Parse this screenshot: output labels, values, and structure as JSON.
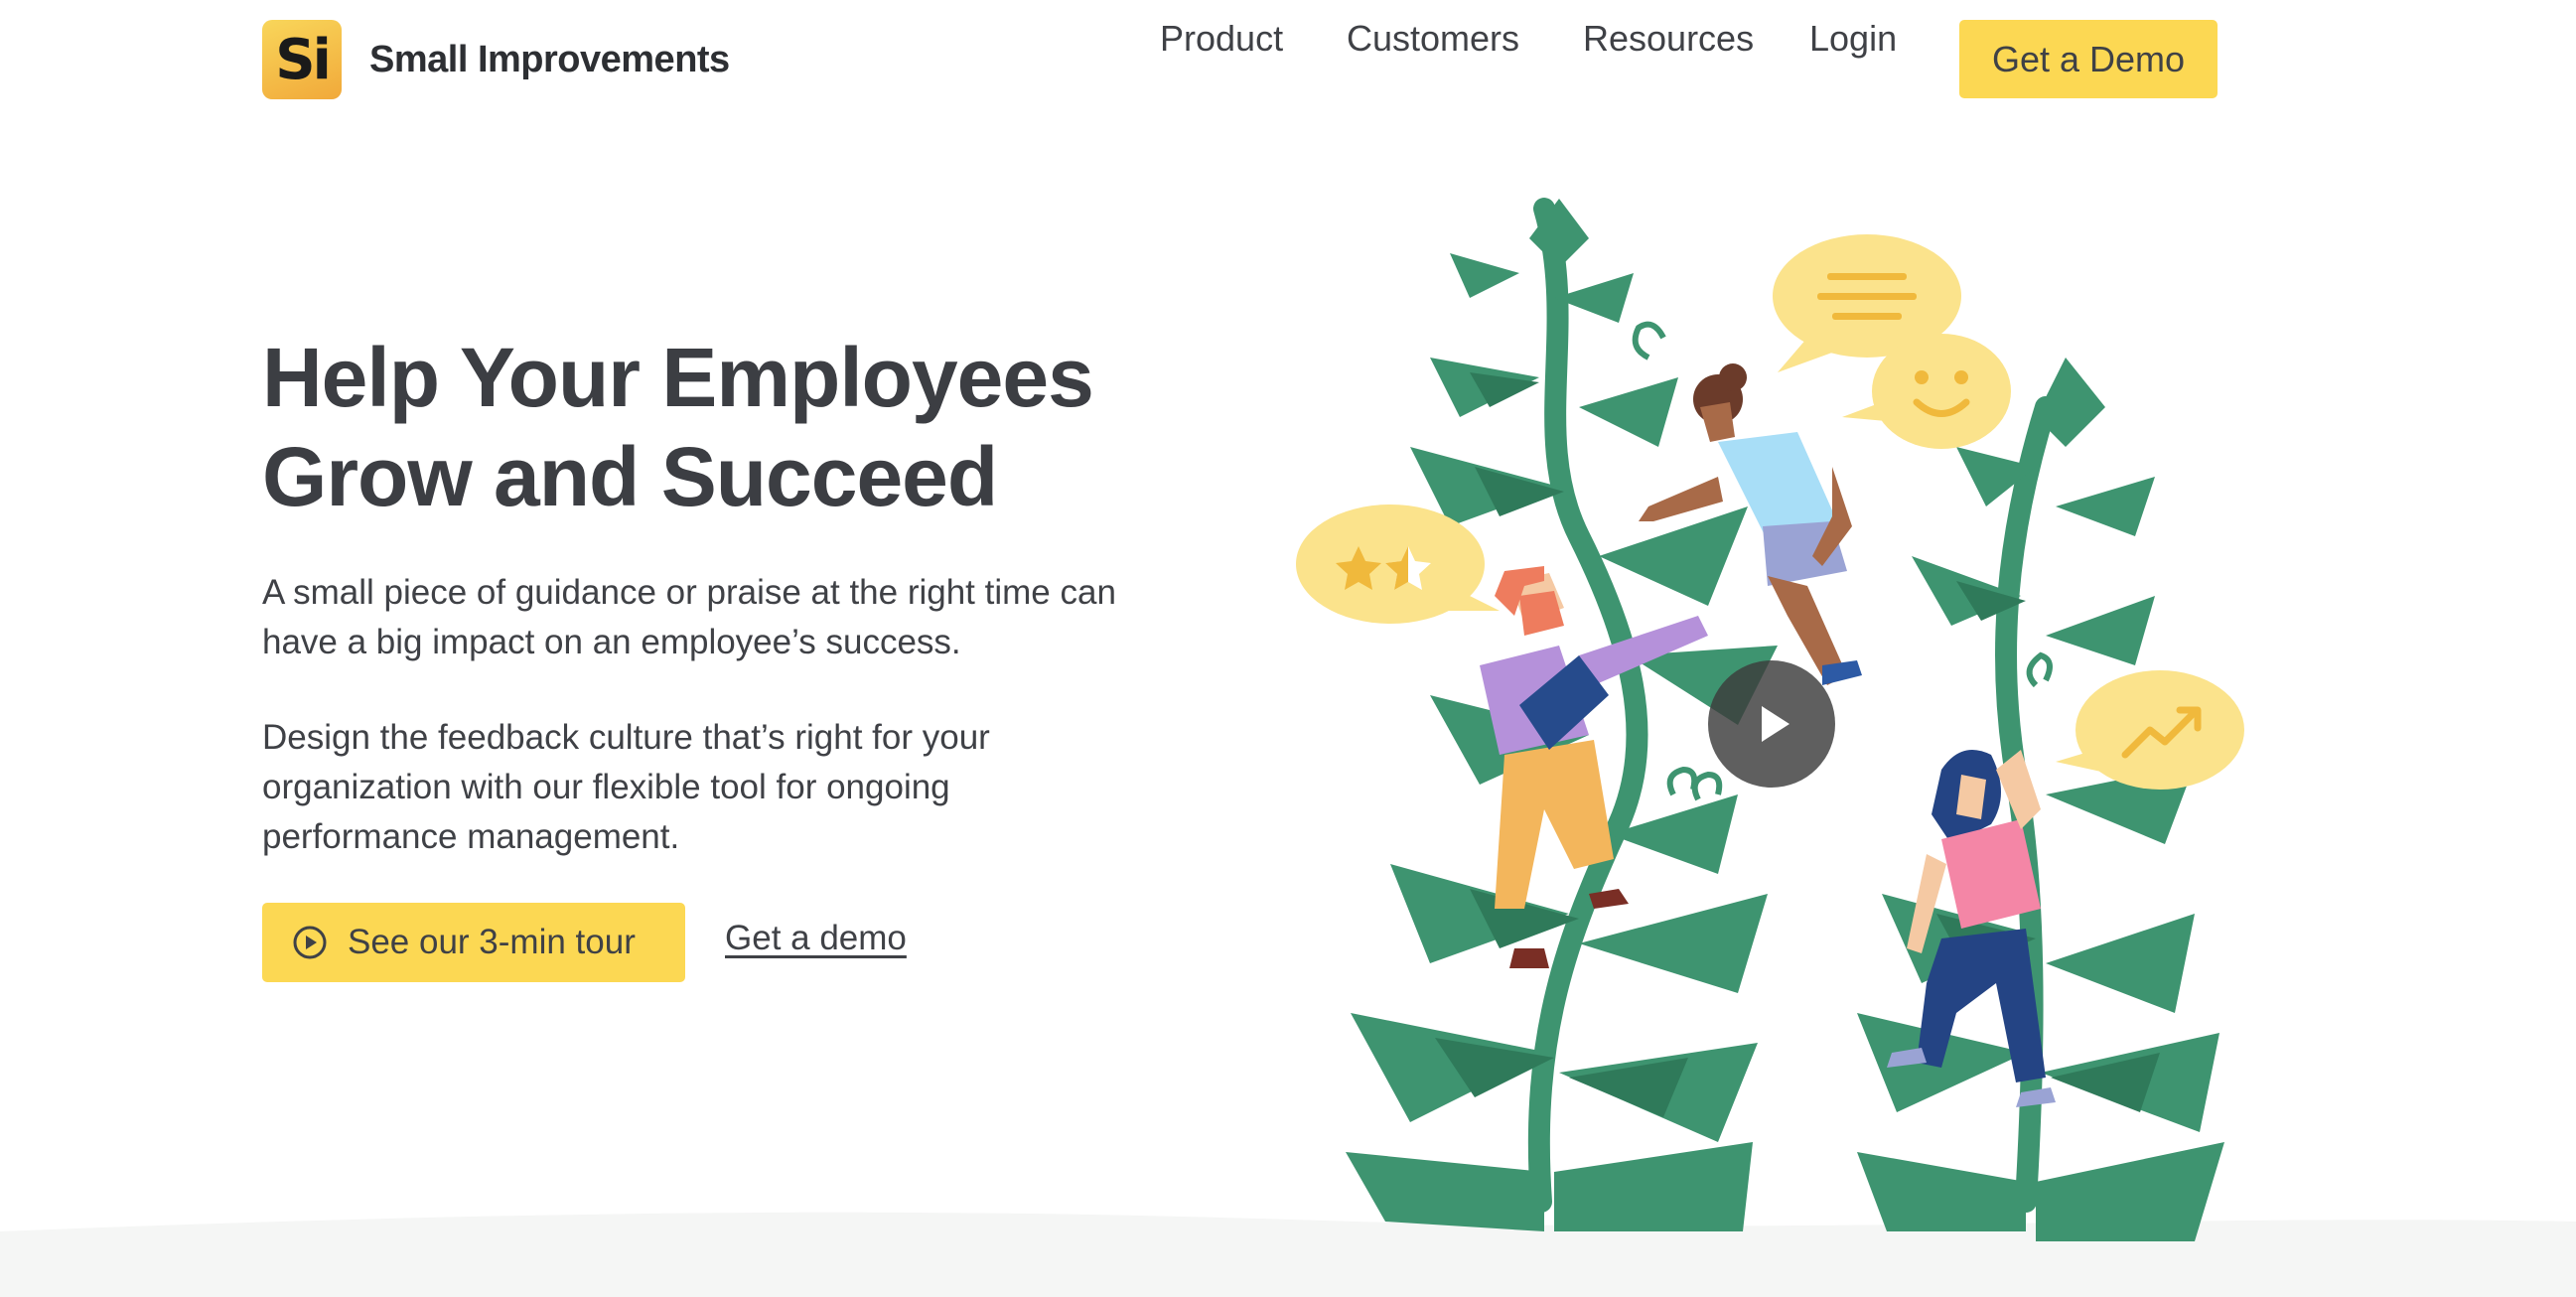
{
  "brand": {
    "logo_mark": "Si",
    "name": "Small Improvements"
  },
  "nav": {
    "items": [
      {
        "label": "Product"
      },
      {
        "label": "Customers"
      },
      {
        "label": "Resources"
      },
      {
        "label": "Login"
      }
    ],
    "cta": "Get a Demo"
  },
  "hero": {
    "title_line1": "Help Your Employees",
    "title_line2": "Grow and Succeed",
    "para1_line1": "A small piece of guidance or praise at the right time can",
    "para1_line2": "have a big impact on an employee’s success.",
    "para2_line1": "Design the feedback culture that’s right for your",
    "para2_line2": "organization with our flexible tool for ongoing",
    "para2_line3": "performance management.",
    "tour_button": "See our 3-min tour",
    "demo_link": "Get a demo"
  },
  "illustration": {
    "icons": [
      "rating-stars-icon",
      "message-lines-icon",
      "smiley-icon",
      "growth-arrow-icon",
      "video-play-icon"
    ]
  },
  "colors": {
    "accent": "#fcd853",
    "leaf": "#3e9470",
    "leaf_dark": "#2f7a5a",
    "bubble": "#fbe38c",
    "text": "#3d3f44"
  }
}
